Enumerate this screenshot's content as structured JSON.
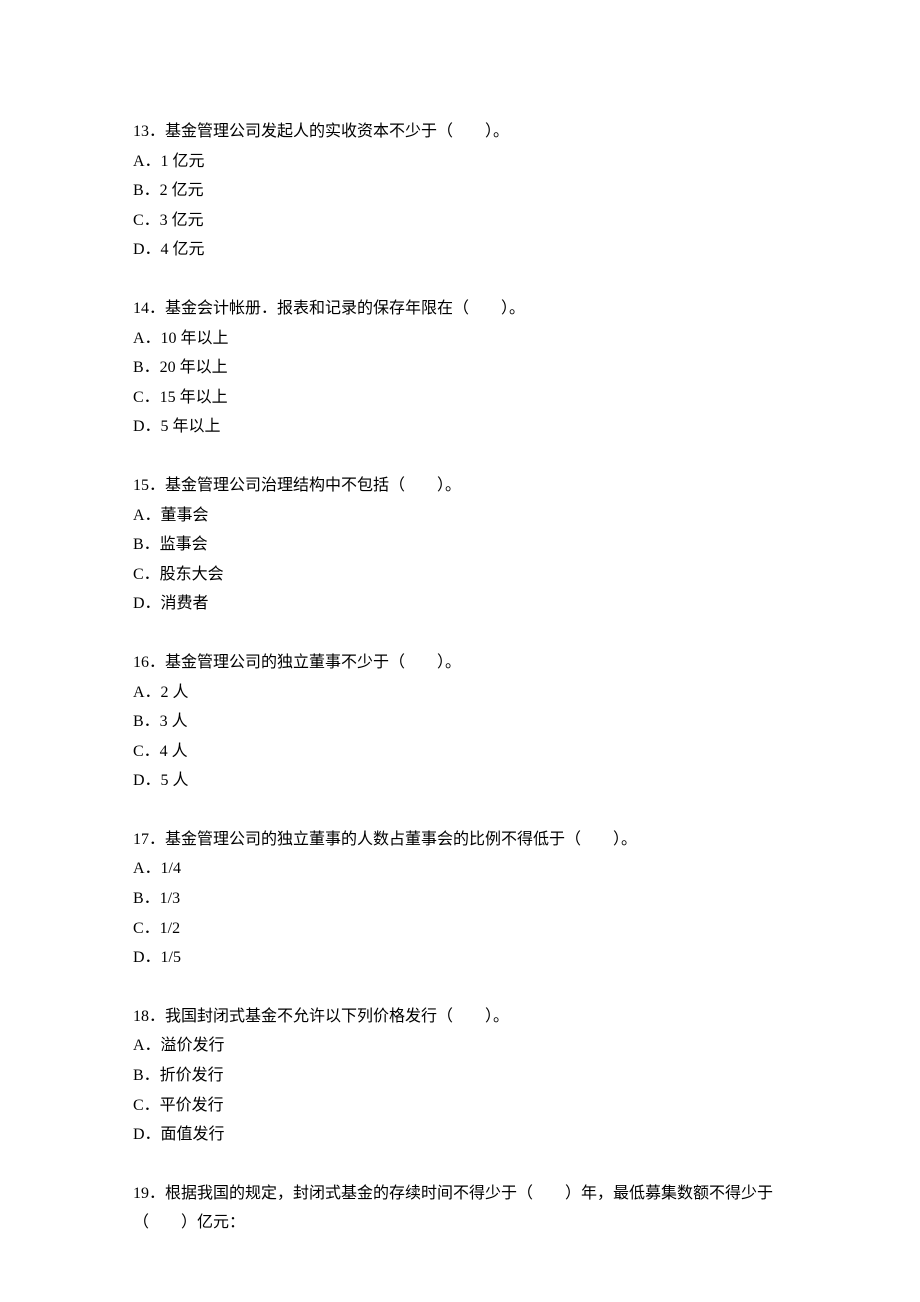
{
  "questions": [
    {
      "number": "13",
      "text": "．基金管理公司发起人的实收资本不少于（　　）。",
      "options": [
        "A．1 亿元",
        "B．2 亿元",
        "C．3 亿元",
        "D．4 亿元"
      ]
    },
    {
      "number": "14",
      "text": "．基金会计帐册．报表和记录的保存年限在（　　）。",
      "options": [
        "A．10 年以上",
        "B．20 年以上",
        "C．15 年以上",
        "D．5 年以上"
      ]
    },
    {
      "number": "15",
      "text": "．基金管理公司治理结构中不包括（　　）。",
      "options": [
        "A．董事会",
        "B．监事会",
        "C．股东大会",
        "D．消费者"
      ]
    },
    {
      "number": "16",
      "text": "．基金管理公司的独立董事不少于（　　）。",
      "options": [
        "A．2 人",
        "B．3 人",
        "C．4 人",
        "D．5 人"
      ]
    },
    {
      "number": "17",
      "text": "．基金管理公司的独立董事的人数占董事会的比例不得低于（　　）。",
      "options": [
        "A．1/4",
        "B．1/3",
        "C．1/2",
        "D．1/5"
      ]
    },
    {
      "number": "18",
      "text": "．我国封闭式基金不允许以下列价格发行（　　）。",
      "options": [
        "A．溢价发行",
        "B．折价发行",
        "C．平价发行",
        "D．面值发行"
      ]
    },
    {
      "number": "19",
      "text": "．根据我国的规定，封闭式基金的存续时间不得少于（　　）年，最低募集数额不得少于（　　）亿元：",
      "options": []
    }
  ]
}
